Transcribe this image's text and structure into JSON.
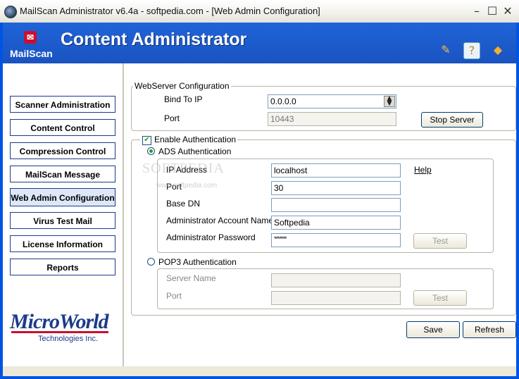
{
  "window": {
    "title": "MailScan Administrator v6.4a - softpedia.com - [Web Admin Configuration]",
    "minimize_glyph": "–",
    "maximize_glyph": "☐",
    "close_glyph": "✕"
  },
  "header": {
    "title": "Content Administrator",
    "logo_text": "MailScan",
    "icons": [
      "pencil-icon",
      "help-icon",
      "eraser-icon"
    ]
  },
  "sidebar": {
    "items": [
      {
        "label": "Scanner Administration"
      },
      {
        "label": "Content Control"
      },
      {
        "label": "Compression Control"
      },
      {
        "label": "MailScan Message"
      },
      {
        "label": "Web Admin Configuration"
      },
      {
        "label": "Virus Test Mail"
      },
      {
        "label": "License Information"
      },
      {
        "label": "Reports"
      }
    ],
    "active_index": 4,
    "company_logo_name": "MicroWorld",
    "company_logo_sub": "Technologies Inc."
  },
  "webserver": {
    "legend": "WebServer Configuration",
    "bind_label": "Bind To IP",
    "bind_value": "0.0.0.0",
    "port_label": "Port",
    "port_value": "10443",
    "stop_button": "Stop Server"
  },
  "auth": {
    "enable_label": "Enable Authentication",
    "enabled": true,
    "ads_label": "ADS Authentication",
    "ip_label": "IP Address",
    "ip_value": "localhost",
    "help_link": "Help",
    "port_label": "Port",
    "port_value": "30",
    "basedn_label": "Base DN",
    "basedn_value": "",
    "account_label": "Administrator Account Name",
    "account_value": "Softpedia",
    "password_label": "Administrator Password",
    "password_value": "*******",
    "test_button": "Test",
    "pop3_label": "POP3 Authentication",
    "server_label": "Server Name",
    "server_value": "",
    "pop3_port_label": "Port",
    "pop3_port_value": "",
    "pop3_test_button": "Test"
  },
  "footer": {
    "save_button": "Save",
    "refresh_button": "Refresh"
  },
  "watermark": {
    "text": "SOFTPEDIA",
    "url": "www.softpedia.com"
  },
  "colors": {
    "header_blue": "#1f64d8",
    "nav_border": "#1c3a8a",
    "brand_red": "#c8102e"
  }
}
